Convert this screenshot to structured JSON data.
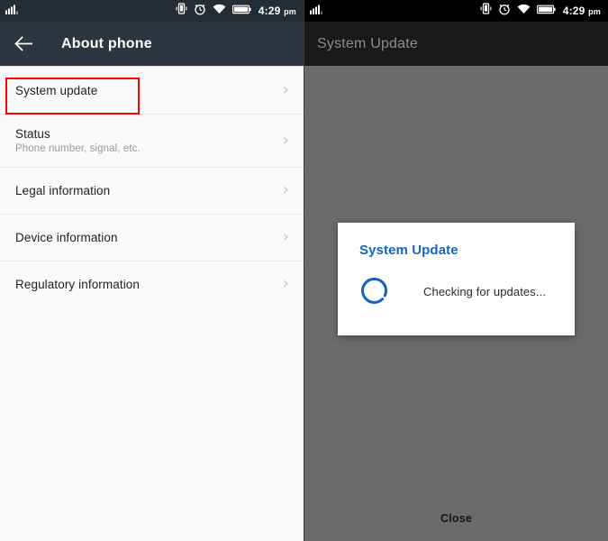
{
  "left_screen": {
    "statusbar": {
      "signal_icon": "signal-bars-icon",
      "vibrate_icon": "vibrate-icon",
      "alarm_icon": "alarm-clock-icon",
      "wifi_icon": "wifi-icon",
      "battery_icon": "battery-full-icon",
      "time": "4:29",
      "ampm": "pm"
    },
    "appbar": {
      "back_icon": "back-arrow-icon",
      "title": "About phone"
    },
    "list": [
      {
        "label": "System update",
        "sub": "",
        "chevron": "chevron-right-icon",
        "highlighted": true
      },
      {
        "label": "Status",
        "sub": "Phone number, signal, etc.",
        "chevron": "chevron-right-icon",
        "highlighted": false
      },
      {
        "label": "Legal information",
        "sub": "",
        "chevron": "chevron-right-icon",
        "highlighted": false
      },
      {
        "label": "Device information",
        "sub": "",
        "chevron": "chevron-right-icon",
        "highlighted": false
      },
      {
        "label": "Regulatory information",
        "sub": "",
        "chevron": "chevron-right-icon",
        "highlighted": false
      }
    ],
    "highlight_color": "#ff0000"
  },
  "right_screen": {
    "statusbar": {
      "signal_icon": "signal-bars-icon",
      "vibrate_icon": "vibrate-icon",
      "alarm_icon": "alarm-clock-icon",
      "wifi_icon": "wifi-icon",
      "battery_icon": "battery-full-icon",
      "time": "4:29",
      "ampm": "pm"
    },
    "appbar": {
      "title": "System Update"
    },
    "dialog": {
      "title": "System Update",
      "spinner_icon": "loading-spinner-icon",
      "message": "Checking for updates...",
      "accent_color": "#1565c0"
    },
    "close_label": "Close",
    "scrim_color": "#6b6b6b"
  }
}
